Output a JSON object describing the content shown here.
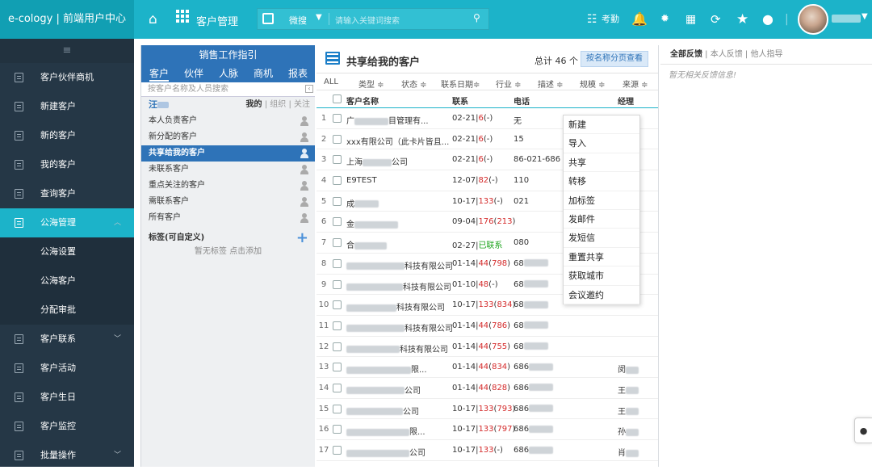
{
  "app": {
    "brand": "e-cology | 前端用户中心",
    "module": "客户管理"
  },
  "topbar": {
    "search_scope": "微搜",
    "search_placeholder": "请输入关键词搜索",
    "attendance_label": "考勤",
    "icons": [
      "home-icon",
      "apps-grid-icon",
      "search-scope-icon",
      "magnifier-icon",
      "calendar-icon",
      "bell-icon",
      "lightbulb-icon",
      "grid-menu-icon",
      "refresh-icon",
      "star-icon",
      "chat-icon"
    ]
  },
  "sidebar": {
    "collapse_icon": "≡",
    "items": [
      {
        "label": "客户伙伴商机"
      },
      {
        "label": "新建客户"
      },
      {
        "label": "新的客户"
      },
      {
        "label": "我的客户"
      },
      {
        "label": "查询客户"
      },
      {
        "label": "公海管理",
        "active": true,
        "expanded": true
      },
      {
        "label": "公海设置",
        "sub": true
      },
      {
        "label": "公海客户",
        "sub": true
      },
      {
        "label": "分配审批",
        "sub": true
      },
      {
        "label": "客户联系",
        "has_children": true
      },
      {
        "label": "客户活动"
      },
      {
        "label": "客户生日"
      },
      {
        "label": "客户监控"
      },
      {
        "label": "批量操作",
        "has_children": true
      }
    ]
  },
  "guide": {
    "header": "销售工作指引",
    "tabs": [
      "客户",
      "伙伴",
      "人脉",
      "商机",
      "报表"
    ],
    "search_placeholder": "按客户名称及人员搜索",
    "owner_prefix": "汪",
    "owner_links": {
      "mine": "我的",
      "sep1": " | ",
      "org": "组织",
      "sep2": " | ",
      "follow": "关注"
    },
    "items": [
      {
        "label": "本人负责客户"
      },
      {
        "label": "新分配的客户"
      },
      {
        "label": "共享给我的客户",
        "selected": true
      },
      {
        "label": "未联系客户"
      },
      {
        "label": "重点关注的客户"
      },
      {
        "label": "需联系客户"
      },
      {
        "label": "所有客户"
      }
    ],
    "tags_title": "标签(可自定义)",
    "tags_empty": "暂无标签 点击添加"
  },
  "main": {
    "title": "共享给我的客户",
    "total": "总计 46 个",
    "page_button": "按名称分页查看",
    "filters": [
      "ALL",
      "类型 ≑",
      "状态 ≑",
      "联系日期≑",
      "行业 ≑",
      "描述 ≑",
      "规模 ≑",
      "来源 ≑"
    ],
    "columns": [
      "客户名称",
      "联系",
      "电话",
      "经理"
    ],
    "rows": [
      {
        "n": "1",
        "name": "广",
        "name_tail": "目管理有...",
        "date": "02-21",
        "c1": "6",
        "c2": "-",
        "phone": "无",
        "mgr": ""
      },
      {
        "n": "2",
        "name": "xxx有限公司（此卡片皆且...",
        "name_tail": "",
        "date": "02-21",
        "c1": "6",
        "c2": "-",
        "phone": "15",
        "mgr": ""
      },
      {
        "n": "3",
        "name": "上海",
        "name_tail": "公司",
        "date": "02-21",
        "c1": "6",
        "c2": "-",
        "phone": "86-021-686",
        "mgr": ""
      },
      {
        "n": "4",
        "name": "E9TEST",
        "name_tail": "",
        "date": "12-07",
        "c1": "82",
        "c2": "-",
        "phone": "110",
        "mgr": ""
      },
      {
        "n": "5",
        "name": "成",
        "name_tail": "",
        "date": "10-17",
        "c1": "133",
        "c2": "-",
        "phone": "021",
        "mgr": ""
      },
      {
        "n": "6",
        "name": "金",
        "name_tail": "",
        "date": "09-04",
        "c1": "176",
        "c2": "213",
        "phone": "",
        "mgr": ""
      },
      {
        "n": "7",
        "name": "合",
        "name_tail": "",
        "date": "02-27",
        "status": "已联系",
        "phone": "080",
        "mgr": ""
      },
      {
        "n": "8",
        "name": "",
        "name_tail": "科技有限公司",
        "date": "01-14",
        "c1": "44",
        "c2": "798",
        "phone": "68",
        "mgr": ""
      },
      {
        "n": "9",
        "name": "",
        "name_tail": "科技有限公司",
        "date": "01-10",
        "c1": "48",
        "c2": "-",
        "phone": "68",
        "mgr": ""
      },
      {
        "n": "10",
        "name": "",
        "name_tail": "科技有限公司",
        "date": "10-17",
        "c1": "133",
        "c2": "834",
        "phone": "68",
        "mgr": ""
      },
      {
        "n": "11",
        "name": "",
        "name_tail": "科技有限公司",
        "date": "01-14",
        "c1": "44",
        "c2": "786",
        "phone": "68",
        "mgr": ""
      },
      {
        "n": "12",
        "name": "",
        "name_tail": "科技有限公司",
        "date": "01-14",
        "c1": "44",
        "c2": "755",
        "phone": "68",
        "mgr": ""
      },
      {
        "n": "13",
        "name": "",
        "name_tail": "限...",
        "date": "01-14",
        "c1": "44",
        "c2": "834",
        "phone": "686",
        "mgr": "闵"
      },
      {
        "n": "14",
        "name": "",
        "name_tail": "公司",
        "date": "01-14",
        "c1": "44",
        "c2": "828",
        "phone": "686",
        "mgr": "王"
      },
      {
        "n": "15",
        "name": "",
        "name_tail": "公司",
        "date": "10-17",
        "c1": "133",
        "c2": "793",
        "phone": "686",
        "mgr": "王"
      },
      {
        "n": "16",
        "name": "",
        "name_tail": "限...",
        "date": "10-17",
        "c1": "133",
        "c2": "797",
        "phone": "686",
        "mgr": "孙"
      },
      {
        "n": "17",
        "name": "",
        "name_tail": "公司",
        "date": "10-17",
        "c1": "133",
        "c2": "-",
        "phone": "686",
        "mgr": "肖"
      }
    ]
  },
  "context_menu": [
    "新建",
    "导入",
    "共享",
    "转移",
    "加标签",
    "发邮件",
    "发短信",
    "重置共享",
    "获取城市",
    "会议邀约"
  ],
  "feedback": {
    "tabs": {
      "all": "全部反馈",
      "mine": "本人反馈",
      "others": "他人指导"
    },
    "empty": "暂无相关反馈信息!"
  }
}
